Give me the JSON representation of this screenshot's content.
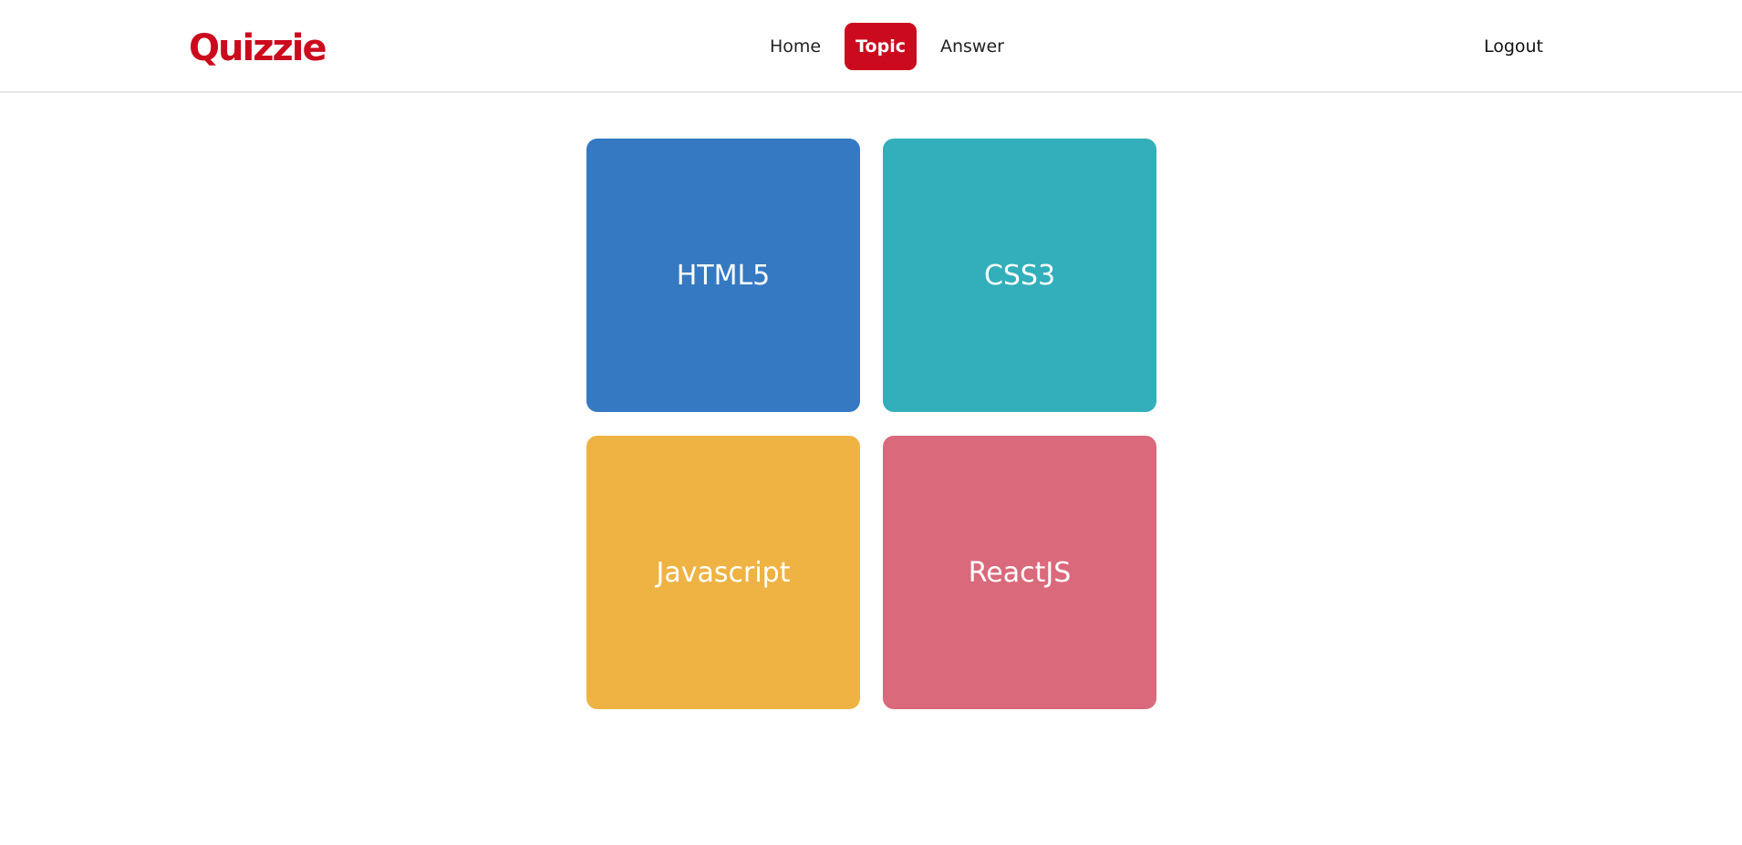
{
  "header": {
    "logo_text": "Quizzie",
    "logo_color": "#cc0a1e",
    "nav": [
      {
        "label": "Home",
        "active": false
      },
      {
        "label": "Topic",
        "active": true
      },
      {
        "label": "Answer",
        "active": false
      }
    ],
    "logout_label": "Logout"
  },
  "topics": [
    {
      "label": "HTML5",
      "color": "#3579c2"
    },
    {
      "label": "CSS3",
      "color": "#32afbb"
    },
    {
      "label": "Javascript",
      "color": "#eeb343"
    },
    {
      "label": "ReactJS",
      "color": "#da697b"
    }
  ]
}
